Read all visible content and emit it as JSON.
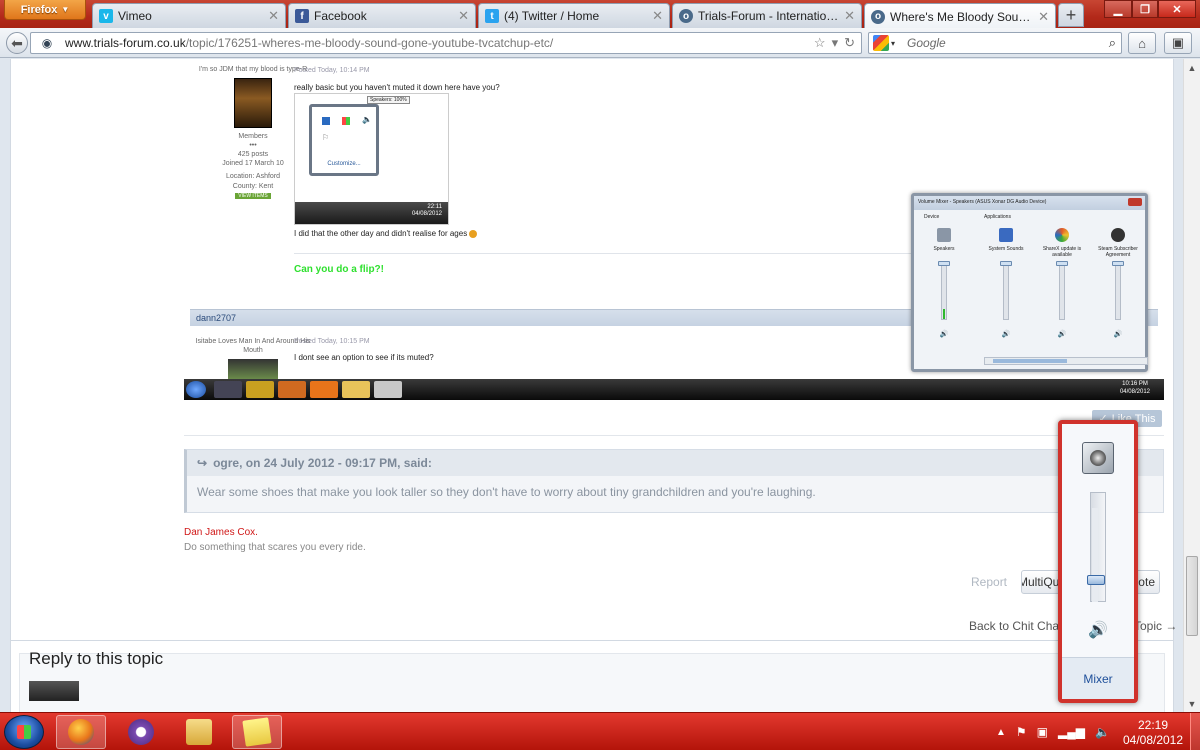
{
  "browser": {
    "menu_button": "Firefox",
    "tabs": [
      {
        "label": "Vimeo",
        "icon": "vimeo-icon",
        "color": "#1ab7ea"
      },
      {
        "label": "Facebook",
        "icon": "facebook-icon",
        "color": "#3b5998"
      },
      {
        "label": "(4) Twitter / Home",
        "icon": "twitter-icon",
        "color": "#2aa3ef"
      },
      {
        "label": "Trials-Forum - International ...",
        "icon": "forum-icon",
        "color": "#4a6a8a"
      },
      {
        "label": "Where's Me Bloody Sound G...",
        "icon": "forum-icon",
        "color": "#4a6a8a"
      }
    ],
    "url_domain": "www.trials-forum.co.uk",
    "url_path": "/topic/176251-wheres-me-bloody-sound-gone-youtube-tvcatchup-etc/",
    "search_placeholder": "Google"
  },
  "screenshot_post": {
    "author_title": "I'm so JDM that my blood is type-R",
    "group": "Members",
    "pips": "•••",
    "posts": "425 posts",
    "joined": "Joined 17 March 10",
    "location": "Location: Ashford",
    "county": "County: Kent",
    "view_items": "VIEW ITEMS",
    "posted1": "Posted Today, 10:14 PM",
    "text1": "really basic but you haven't muted it down here have you?",
    "tooltip": "Speakers: 100%",
    "customize": "Customize...",
    "tray_time": "22:11",
    "tray_date": "04/08/2012",
    "text2": "I did that the other day and didn't realise for ages",
    "flip": "Can you do a flip?!",
    "author2": "dann2707",
    "author2_title": "Isitabe Loves Man In And Around His Mouth",
    "posted2": "Posted Today, 10:15 PM",
    "text3": "I dont see an option to see if its muted?",
    "inner_clock_time": "10:16 PM",
    "inner_clock_date": "04/08/2012",
    "mixer": {
      "title": "Volume Mixer - Speakers (ASUS Xonar DG Audio Device)",
      "device_group": "Device",
      "apps_group": "Applications",
      "columns": [
        {
          "label": "Speakers",
          "icon_color": "#8a96a6"
        },
        {
          "label": "System Sounds",
          "icon_color": "#3a6ac0"
        },
        {
          "label": "ShareX update is available",
          "icon_color": "#e05a2a"
        },
        {
          "label": "Steam Subscriber Agreement",
          "icon_color": "#333"
        }
      ]
    }
  },
  "page": {
    "like_button": "Like This",
    "quote_header": "ogre, on 24 July 2012 - 09:17 PM, said:",
    "quote_body": "Wear some shoes that make you look taller so they don't have to worry about tiny grandchildren and you're laughing.",
    "signature_name": "Dan James Cox.",
    "signature_text": "Do something that scares you every ride.",
    "report": "Report",
    "multiquote": "MultiQuote",
    "quote_button": "Quote",
    "back_link": "Back to Chit Chat",
    "topic_link": "Topic →",
    "reply_title": "Reply to this topic"
  },
  "volume_flyout": {
    "mixer_label": "Mixer",
    "level_percent": 20
  },
  "taskbar": {
    "clock_time": "22:19",
    "clock_date": "04/08/2012",
    "apps": [
      {
        "name": "firefox",
        "color": "#e8741a",
        "pressed": true
      },
      {
        "name": "bittorrent",
        "color": "#7a4ab0",
        "pressed": false
      },
      {
        "name": "explorer",
        "color": "#e8c35a",
        "pressed": false
      },
      {
        "name": "sticky-notes",
        "color": "#f5e66a",
        "pressed": true
      }
    ]
  }
}
